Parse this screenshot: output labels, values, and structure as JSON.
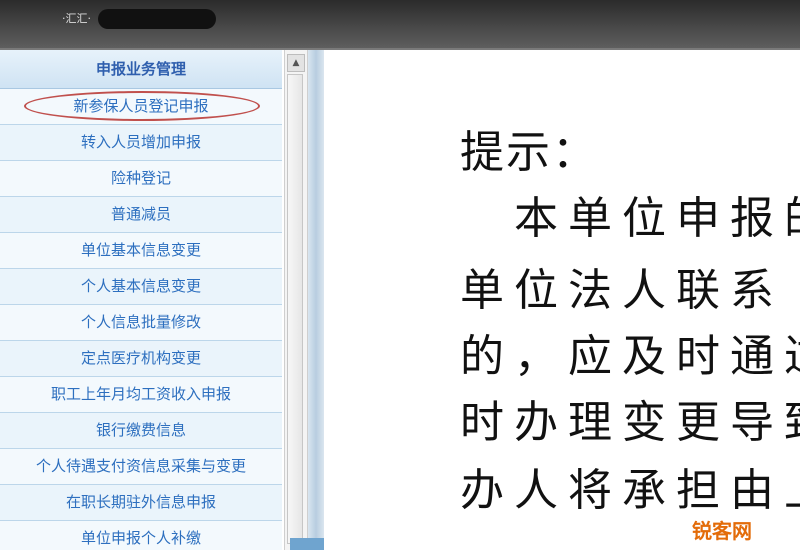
{
  "window": {
    "title": "·汇汇·"
  },
  "sidebar": {
    "header": "申报业务管理",
    "items": [
      {
        "label": "新参保人员登记申报",
        "highlighted": true
      },
      {
        "label": "转入人员增加申报"
      },
      {
        "label": "险种登记"
      },
      {
        "label": "普通减员"
      },
      {
        "label": "单位基本信息变更"
      },
      {
        "label": "个人基本信息变更"
      },
      {
        "label": "个人信息批量修改"
      },
      {
        "label": "定点医疗机构变更"
      },
      {
        "label": "职工上年月均工资收入申报"
      },
      {
        "label": "银行缴费信息"
      },
      {
        "label": "个人待遇支付资信息采集与变更"
      },
      {
        "label": "在职长期驻外信息申报"
      },
      {
        "label": "单位申报个人补缴"
      }
    ]
  },
  "content": {
    "tip_title": "提示：",
    "lines": [
      "　本单位申报的",
      "单位法人联系",
      "的，应及时通过",
      "时办理变更导致",
      "办人将承担由上"
    ]
  },
  "watermark": "锐客网",
  "colors": {
    "header_bar": "#3a3a3a",
    "sidebar_bg": "#eef6fb",
    "menu_text": "#2d6fbf",
    "highlight_circle": "#c0504d",
    "watermark": "#e36c09"
  }
}
